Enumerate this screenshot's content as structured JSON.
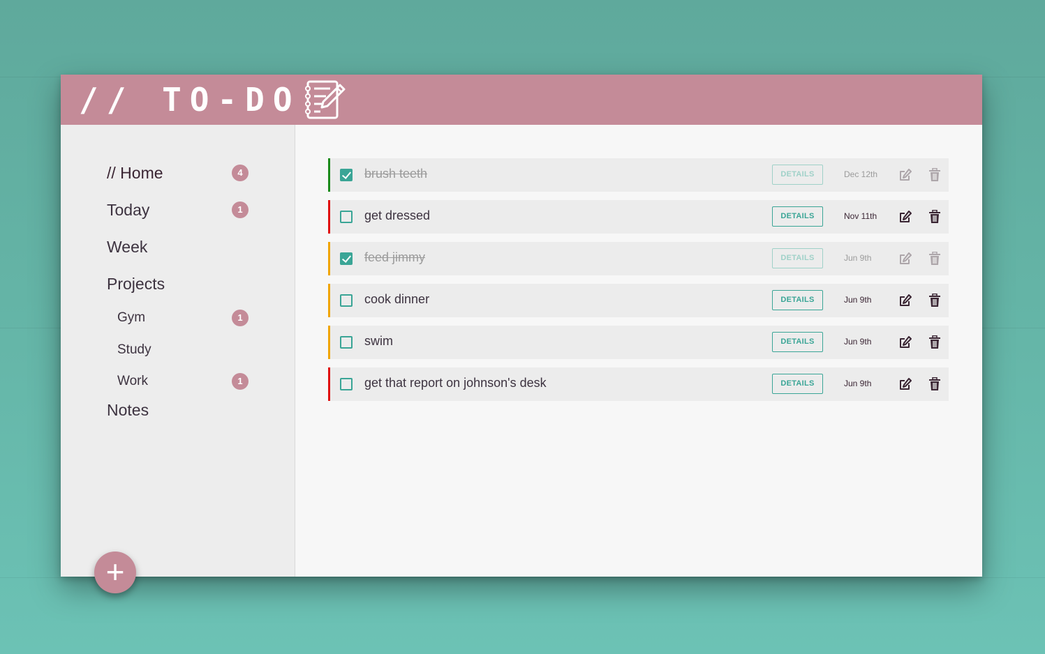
{
  "app": {
    "title": "// TO-DO",
    "logo_icon": "notepad-pencil-icon"
  },
  "colors": {
    "accent": "#c48b98",
    "teal": "#3aa596",
    "priority_low": "#1a8a1a",
    "priority_medium": "#f0a500",
    "priority_high": "#e01010"
  },
  "sidebar": {
    "home": {
      "label": "// Home",
      "count": "4"
    },
    "today": {
      "label": "Today",
      "count": "1"
    },
    "week": {
      "label": "Week"
    },
    "projects": {
      "label": "Projects",
      "items": [
        {
          "label": "Gym",
          "count": "1"
        },
        {
          "label": "Study",
          "count": ""
        },
        {
          "label": "Work",
          "count": "1"
        }
      ]
    },
    "notes": {
      "label": "Notes"
    },
    "add_button": "+"
  },
  "tasks": [
    {
      "title": "brush teeth",
      "done": true,
      "priority": "low",
      "details_label": "DETAILS",
      "date": "Dec 12th"
    },
    {
      "title": "get dressed",
      "done": false,
      "priority": "high",
      "details_label": "DETAILS",
      "date": "Nov 11th"
    },
    {
      "title": "feed jimmy",
      "done": true,
      "priority": "medium",
      "details_label": "DETAILS",
      "date": "Jun 9th"
    },
    {
      "title": "cook dinner",
      "done": false,
      "priority": "medium",
      "details_label": "DETAILS",
      "date": "Jun 9th"
    },
    {
      "title": "swim",
      "done": false,
      "priority": "medium",
      "details_label": "DETAILS",
      "date": "Jun 9th"
    },
    {
      "title": "get that report on johnson's desk",
      "done": false,
      "priority": "high",
      "details_label": "DETAILS",
      "date": "Jun 9th"
    }
  ]
}
